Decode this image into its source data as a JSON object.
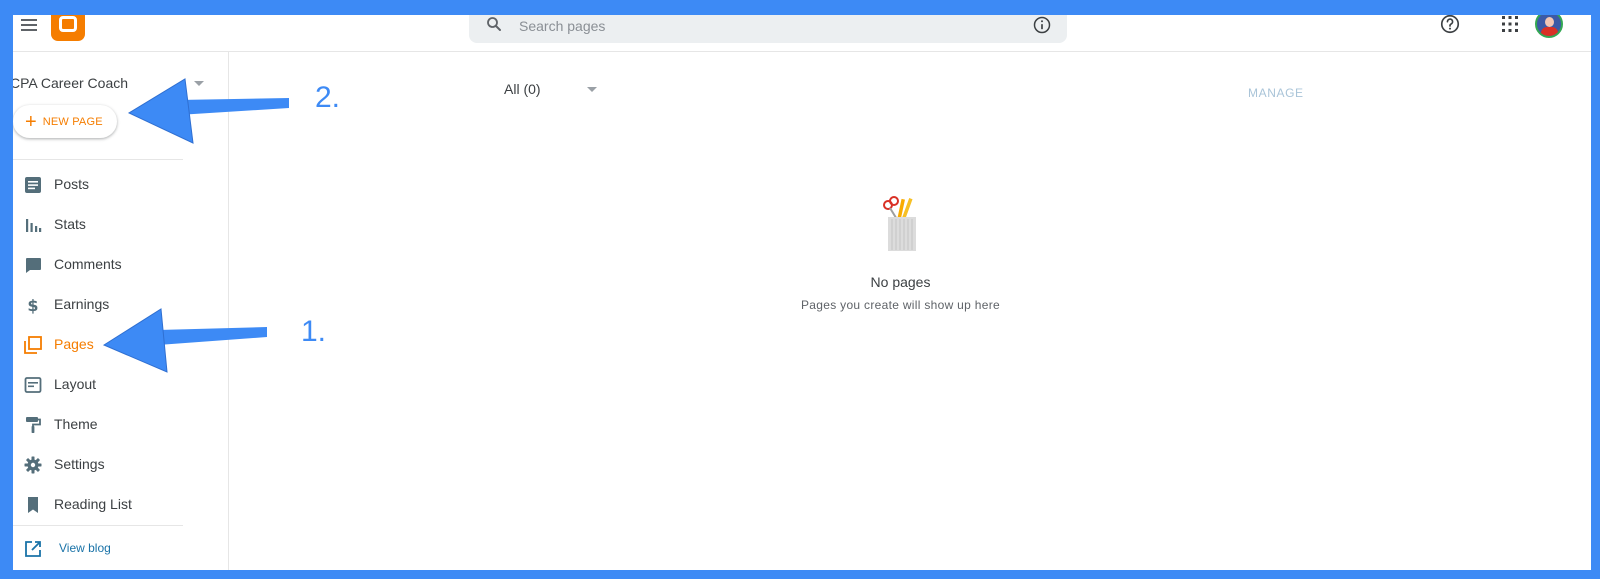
{
  "topbar": {
    "search": {
      "placeholder": "Search pages"
    }
  },
  "sidebar": {
    "blog_name": "CPA Career Coach",
    "new_page_label": "NEW PAGE",
    "items": [
      {
        "label": "Posts",
        "icon": "posts-icon"
      },
      {
        "label": "Stats",
        "icon": "stats-icon"
      },
      {
        "label": "Comments",
        "icon": "comments-icon"
      },
      {
        "label": "Earnings",
        "icon": "dollar-icon"
      },
      {
        "label": "Pages",
        "icon": "pages-icon",
        "active": true
      },
      {
        "label": "Layout",
        "icon": "layout-icon"
      },
      {
        "label": "Theme",
        "icon": "paint-roller-icon"
      },
      {
        "label": "Settings",
        "icon": "gear-icon"
      },
      {
        "label": "Reading List",
        "icon": "bookmark-icon"
      }
    ],
    "view_blog_label": "View blog"
  },
  "main": {
    "filter_label": "All (0)",
    "manage_label": "MANAGE",
    "empty_title": "No pages",
    "empty_subtitle": "Pages you create will show up here"
  },
  "annotations": {
    "step1": "1.",
    "step2": "2."
  },
  "colors": {
    "accent": "#f57d00",
    "frame_border": "#3d8af5",
    "icon_gray": "#546e7a",
    "link": "#1a73a8"
  }
}
